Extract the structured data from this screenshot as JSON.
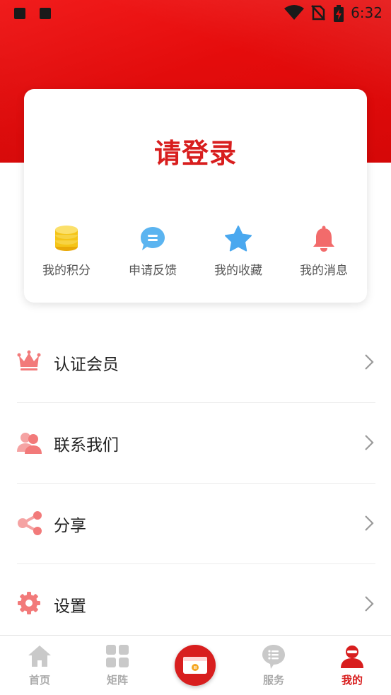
{
  "status_bar": {
    "time": "6:32",
    "icons": [
      "notification-square-icon",
      "notification-square-icon",
      "wifi-icon",
      "no-sim-icon",
      "battery-charging-icon"
    ]
  },
  "login_card": {
    "title": "请登录",
    "quick_actions": [
      {
        "label": "我的积分",
        "icon": "coins-icon",
        "color": "#f5c518"
      },
      {
        "label": "申请反馈",
        "icon": "chat-bubble-icon",
        "color": "#5bb4f0"
      },
      {
        "label": "我的收藏",
        "icon": "star-icon",
        "color": "#4aa8ef"
      },
      {
        "label": "我的消息",
        "icon": "bell-icon",
        "color": "#f26b6b"
      }
    ]
  },
  "menu": [
    {
      "label": "认证会员",
      "icon": "crown-icon"
    },
    {
      "label": "联系我们",
      "icon": "contacts-icon"
    },
    {
      "label": "分享",
      "icon": "share-icon"
    },
    {
      "label": "设置",
      "icon": "gear-icon"
    }
  ],
  "bottom_nav": {
    "items": [
      {
        "label": "首页",
        "icon": "home-icon",
        "active": false
      },
      {
        "label": "矩阵",
        "icon": "grid-icon",
        "active": false
      },
      {
        "label": "服务",
        "icon": "service-icon",
        "active": false
      },
      {
        "label": "我的",
        "icon": "profile-icon",
        "active": true
      }
    ],
    "center_icon": "ticket-icon"
  },
  "colors": {
    "brand_red": "#d81e1e",
    "header_red": "#e50c0c",
    "menu_icon_pink": "#f27a7a",
    "inactive_gray": "#aaaaaa"
  }
}
